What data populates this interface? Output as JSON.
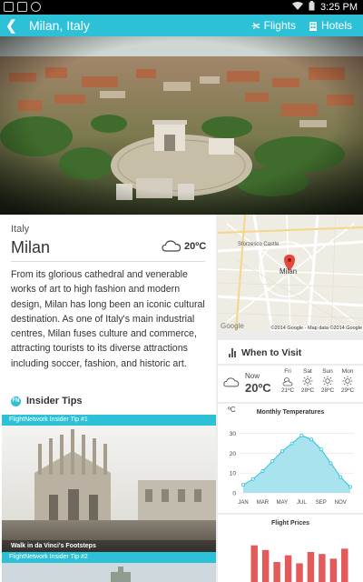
{
  "status_bar": {
    "time": "3:25 PM"
  },
  "app_bar": {
    "title": "Milan, Italy",
    "back_glyph": "❮",
    "flights_label": "Flights",
    "hotels_label": "Hotels"
  },
  "destination": {
    "country": "Italy",
    "city": "Milan",
    "current_temp": "20ºC",
    "description": "From its glorious cathedral and venerable works of art to high fashion and modern design, Milan has long been an iconic cultural destination. As one of Italy's main industrial centres, Milan fuses culture and commerce, attracting tourists to its diverse attractions including soccer, fashion, and historic art."
  },
  "insider_tips": {
    "badge": "FN",
    "heading": "Insider Tips",
    "tips": [
      {
        "label": "FlightNetwork Insider Tip #1",
        "title": "Walk in da Vinci's Footsteps"
      },
      {
        "label": "FlightNetwork Insider Tip #2",
        "title": ""
      }
    ]
  },
  "map": {
    "poi_label": "Sforzesco Castle",
    "city_label": "Milan",
    "attribution": "©2014 Google - Map data ©2014 Google",
    "logo": "Google"
  },
  "when_to_visit": {
    "heading": "When to Visit",
    "now_label": "Now",
    "now_temp": "20ºC",
    "forecast": [
      {
        "day": "Fri",
        "icon": "cloud-sun-icon",
        "temp": "21ºC"
      },
      {
        "day": "Sat",
        "icon": "sun-icon",
        "temp": "28ºC"
      },
      {
        "day": "Sun",
        "icon": "sun-icon",
        "temp": "28ºC"
      },
      {
        "day": "Mon",
        "icon": "sun-icon",
        "temp": "29ºC"
      }
    ]
  },
  "chart_data": [
    {
      "type": "area",
      "title": "Monthly Temperatures",
      "unit_label": "ºC",
      "x_tick_labels": [
        "JAN",
        "MAR",
        "MAY",
        "JUL",
        "SEP",
        "NOV"
      ],
      "x": [
        "JAN",
        "FEB",
        "MAR",
        "APR",
        "MAY",
        "JUN",
        "JUL",
        "AUG",
        "SEP",
        "OCT",
        "NOV",
        "DEC"
      ],
      "values": [
        4,
        7,
        11,
        16,
        21,
        25,
        29,
        27,
        22,
        15,
        8,
        3
      ],
      "y_ticks": [
        0,
        10,
        20,
        30
      ],
      "ylim": [
        0,
        34
      ],
      "fill_color": "#a8e3ee",
      "line_color": "#2dc1d8"
    },
    {
      "type": "bar",
      "title": "Flight Prices",
      "values": [
        55,
        48,
        30,
        40,
        28,
        45,
        42,
        35,
        50
      ],
      "ylim": [
        0,
        60
      ],
      "bar_color": "#e35a5a"
    }
  ],
  "colors": {
    "accent": "#2dc1d8",
    "bar": "#e35a5a"
  }
}
